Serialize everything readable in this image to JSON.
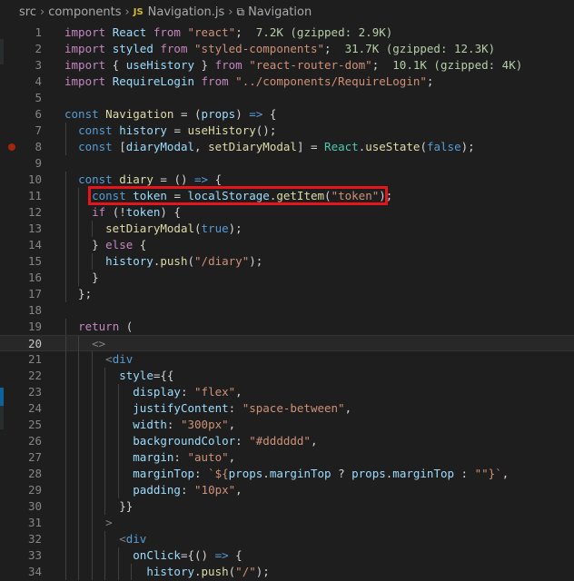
{
  "breadcrumb": {
    "items": [
      "src",
      "components",
      "Navigation.js",
      "Navigation"
    ],
    "file_type_label": "JS"
  },
  "editor": {
    "active_line": 20,
    "breakpoint_line": 8,
    "highlighted_line": 11,
    "lines": [
      {
        "n": "1",
        "html": "<span class='kw2'>import</span> <span class='var'>React</span> <span class='kw2'>from</span> <span class='str'>\"react\"</span>;  <span class='size'>7.2K (gzipped: 2.9K)</span>"
      },
      {
        "n": "2",
        "html": "<span class='kw2'>import</span> <span class='var'>styled</span> <span class='kw2'>from</span> <span class='str'>\"styled-components\"</span>;  <span class='size'>31.7K (gzipped: 12.3K)</span>"
      },
      {
        "n": "3",
        "html": "<span class='kw2'>import</span> { <span class='var'>useHistory</span> } <span class='kw2'>from</span> <span class='str'>\"react-router-dom\"</span>;  <span class='size'>10.1K (gzipped: 4K)</span>"
      },
      {
        "n": "4",
        "html": "<span class='kw2'>import</span> <span class='var'>RequireLogin</span> <span class='kw2'>from</span> <span class='str'>\"../components/RequireLogin\"</span>;"
      },
      {
        "n": "5",
        "html": ""
      },
      {
        "n": "6",
        "html": "<span class='kw'>const</span> <span class='fn'>Navigation</span> = (<span class='var'>props</span>) <span class='kw'>=&gt;</span> {"
      },
      {
        "n": "7",
        "html": "  <span class='kw'>const</span> <span class='var'>history</span> = <span class='fn'>useHistory</span>();"
      },
      {
        "n": "8",
        "html": "  <span class='kw'>const</span> [<span class='var'>diaryModal</span>, <span class='fn'>setDiaryModal</span>] = <span class='cls'>React</span>.<span class='fn'>useState</span>(<span class='kw'>false</span>);"
      },
      {
        "n": "9",
        "html": ""
      },
      {
        "n": "10",
        "html": "  <span class='kw'>const</span> <span class='fn'>diary</span> = () <span class='kw'>=&gt;</span> {"
      },
      {
        "n": "11",
        "html": "    <span class='kw'>const</span> <span class='var'>token</span> = <span class='var'>localStorage</span>.<span class='fn'>getItem</span>(<span class='str'>\"token\"</span>);"
      },
      {
        "n": "12",
        "html": "    <span class='kw2'>if</span> (!<span class='var'>token</span>) {"
      },
      {
        "n": "13",
        "html": "      <span class='fn'>setDiaryModal</span>(<span class='kw'>true</span>);"
      },
      {
        "n": "14",
        "html": "    } <span class='kw2'>else</span> {"
      },
      {
        "n": "15",
        "html": "      <span class='var'>history</span>.<span class='fn'>push</span>(<span class='str'>\"/diary\"</span>);"
      },
      {
        "n": "16",
        "html": "    }"
      },
      {
        "n": "17",
        "html": "  };"
      },
      {
        "n": "18",
        "html": ""
      },
      {
        "n": "19",
        "html": "  <span class='kw2'>return</span> ("
      },
      {
        "n": "20",
        "html": "    <span class='tagb'>&lt;&gt;</span>"
      },
      {
        "n": "21",
        "html": "      <span class='tagb'>&lt;</span><span class='tag'>div</span>"
      },
      {
        "n": "22",
        "html": "        <span class='var'>style</span>={{"
      },
      {
        "n": "23",
        "html": "          <span class='var'>display</span>: <span class='str'>\"flex\"</span>,"
      },
      {
        "n": "24",
        "html": "          <span class='var'>justifyContent</span>: <span class='str'>\"space-between\"</span>,"
      },
      {
        "n": "25",
        "html": "          <span class='var'>width</span>: <span class='str'>\"300px\"</span>,"
      },
      {
        "n": "26",
        "html": "          <span class='var'>backgroundColor</span>: <span class='str'>\"#dddddd\"</span>,"
      },
      {
        "n": "27",
        "html": "          <span class='var'>margin</span>: <span class='str'>\"auto\"</span>,"
      },
      {
        "n": "28",
        "html": "          <span class='var'>marginTop</span>: <span class='str'>`${</span><span class='var'>props</span>.<span class='var'>marginTop</span> ? <span class='var'>props</span>.<span class='var'>marginTop</span> : <span class='str'>\"\"</span><span class='str'>}`</span>,"
      },
      {
        "n": "29",
        "html": "          <span class='var'>padding</span>: <span class='str'>\"10px\"</span>,"
      },
      {
        "n": "30",
        "html": "        }}"
      },
      {
        "n": "31",
        "html": "      <span class='tagb'>&gt;</span>"
      },
      {
        "n": "32",
        "html": "        <span class='tagb'>&lt;</span><span class='tag'>div</span>"
      },
      {
        "n": "33",
        "html": "          <span class='var'>onClick</span>={() <span class='kw'>=&gt;</span> {"
      },
      {
        "n": "34",
        "html": "            <span class='var'>history</span>.<span class='fn'>push</span>(<span class='str'>\"/\"</span>);"
      }
    ]
  },
  "colors": {
    "background": "#1e1e1e",
    "highlight_box": "#e5151b",
    "breakpoint": "#a1260d"
  }
}
